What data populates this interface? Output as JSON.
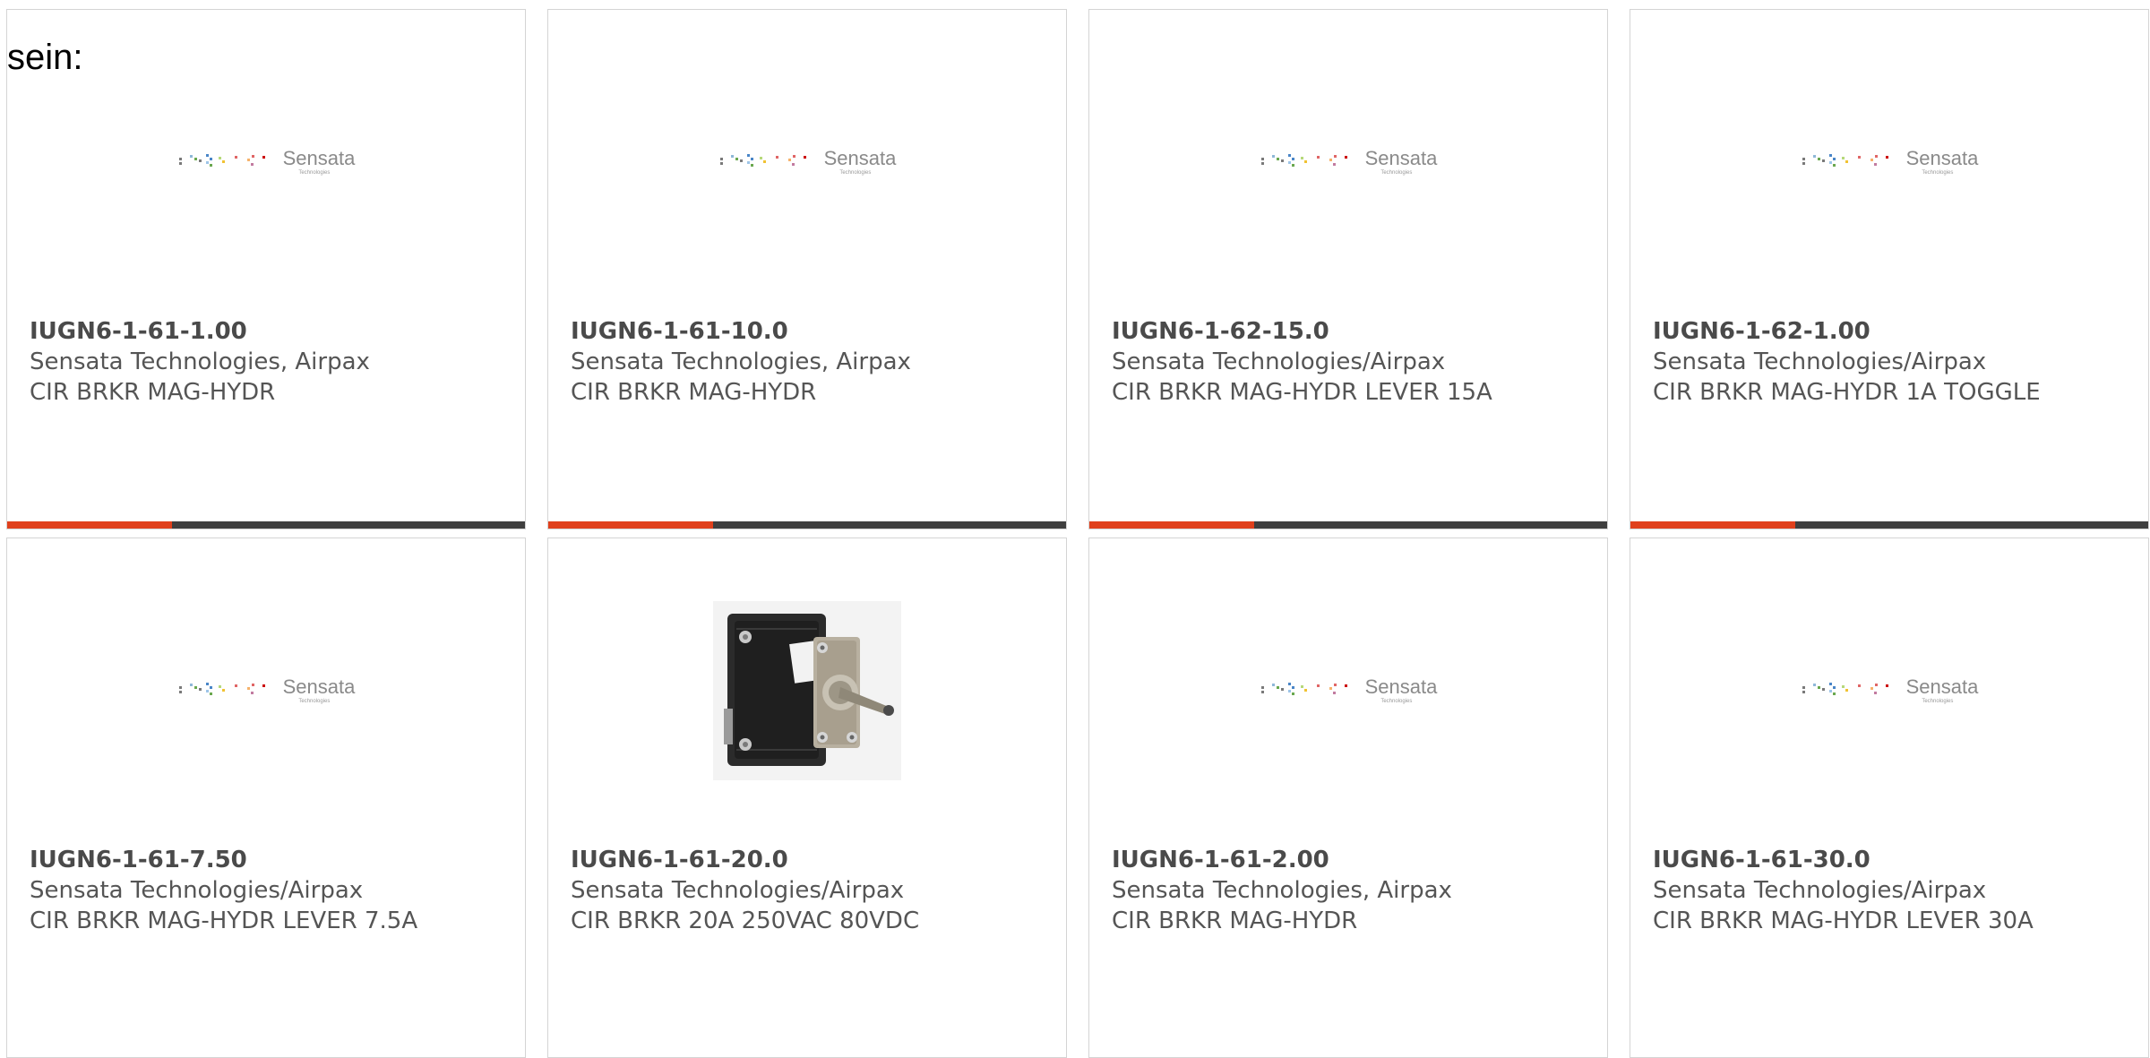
{
  "intro_text": "sein:",
  "colors": {
    "accent_red": "#e0401c",
    "accent_dark": "#3f3f3f",
    "border": "#d4d4d4",
    "text": "#555555"
  },
  "logo": {
    "word": "Sensata",
    "sub": "Technologies"
  },
  "products": [
    {
      "part": "IUGN6-1-61-1.00",
      "manufacturer": "Sensata Technologies, Airpax",
      "description": "CIR BRKR MAG-HYDR",
      "image": "sensata-logo"
    },
    {
      "part": "IUGN6-1-61-10.0",
      "manufacturer": "Sensata Technologies, Airpax",
      "description": "CIR BRKR MAG-HYDR",
      "image": "sensata-logo"
    },
    {
      "part": "IUGN6-1-62-15.0",
      "manufacturer": "Sensata Technologies/Airpax",
      "description": "CIR BRKR MAG-HYDR LEVER 15A",
      "image": "sensata-logo"
    },
    {
      "part": "IUGN6-1-62-1.00",
      "manufacturer": "Sensata Technologies/Airpax",
      "description": "CIR BRKR MAG-HYDR 1A TOGGLE",
      "image": "sensata-logo"
    },
    {
      "part": "IUGN6-1-61-7.50",
      "manufacturer": "Sensata Technologies/Airpax",
      "description": "CIR BRKR MAG-HYDR LEVER 7.5A",
      "image": "sensata-logo"
    },
    {
      "part": "IUGN6-1-61-20.0",
      "manufacturer": "Sensata Technologies/Airpax",
      "description": "CIR BRKR 20A 250VAC 80VDC",
      "image": "breaker-photo"
    },
    {
      "part": "IUGN6-1-61-2.00",
      "manufacturer": "Sensata Technologies, Airpax",
      "description": "CIR BRKR MAG-HYDR",
      "image": "sensata-logo"
    },
    {
      "part": "IUGN6-1-61-30.0",
      "manufacturer": "Sensata Technologies/Airpax",
      "description": "CIR BRKR MAG-HYDR LEVER 30A",
      "image": "sensata-logo"
    }
  ]
}
